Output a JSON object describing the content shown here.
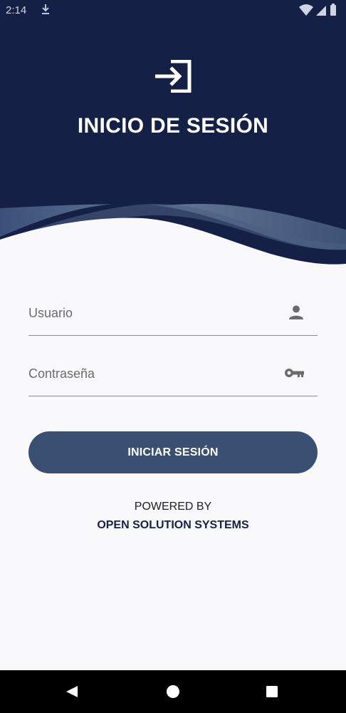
{
  "status_bar": {
    "time": "2:14"
  },
  "header": {
    "title": "INICIO DE SESIÓN",
    "icon": "login-icon"
  },
  "form": {
    "username": {
      "value": "",
      "placeholder": "Usuario",
      "icon": "person-icon"
    },
    "password": {
      "value": "",
      "placeholder": "Contraseña",
      "icon": "key-icon"
    },
    "submit_label": "INICIAR SESIÓN"
  },
  "footer": {
    "powered_by": "POWERED BY",
    "company": "OPEN SOLUTION SYSTEMS"
  },
  "colors": {
    "header_bg": "#142046",
    "wave_light": "#5c6f90",
    "button_bg": "#3a5072",
    "page_bg": "#f9f9fb"
  }
}
